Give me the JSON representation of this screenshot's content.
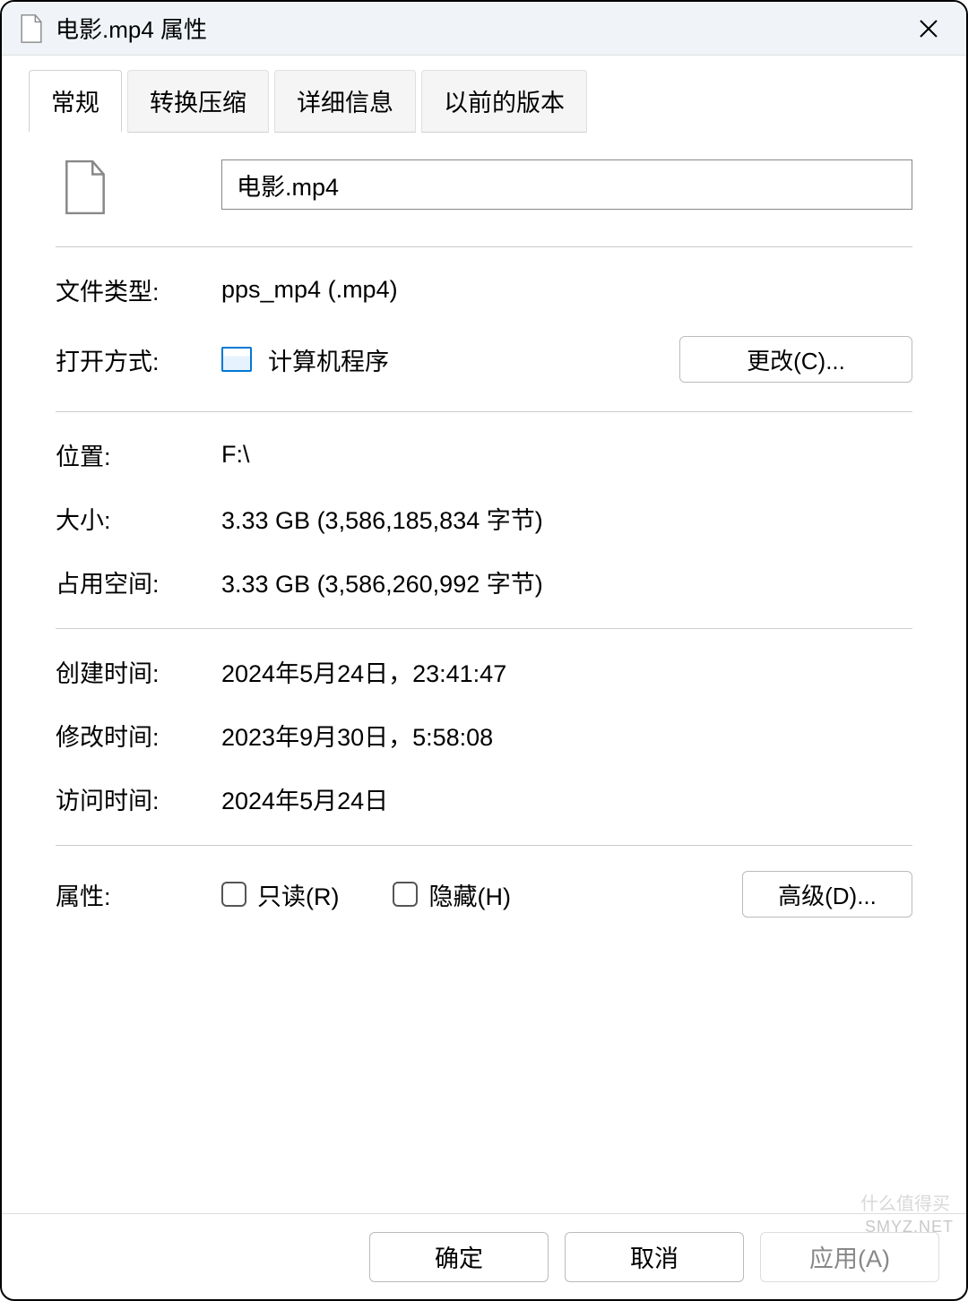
{
  "window": {
    "title": "电影.mp4 属性"
  },
  "tabs": [
    {
      "label": "常规",
      "active": true
    },
    {
      "label": "转换压缩",
      "active": false
    },
    {
      "label": "详细信息",
      "active": false
    },
    {
      "label": "以前的版本",
      "active": false
    }
  ],
  "filename": "电影.mp4",
  "labels": {
    "file_type": "文件类型:",
    "opens_with": "打开方式:",
    "location": "位置:",
    "size": "大小:",
    "size_on_disk": "占用空间:",
    "created": "创建时间:",
    "modified": "修改时间:",
    "accessed": "访问时间:",
    "attributes": "属性:"
  },
  "values": {
    "file_type": "pps_mp4 (.mp4)",
    "opens_with": "计算机程序",
    "location": "F:\\",
    "size": "3.33 GB (3,586,185,834 字节)",
    "size_on_disk": "3.33 GB (3,586,260,992 字节)",
    "created": "2024年5月24日，23:41:47",
    "modified": "2023年9月30日，5:58:08",
    "accessed": "2024年5月24日"
  },
  "buttons": {
    "change": "更改(C)...",
    "advanced": "高级(D)...",
    "ok": "确定",
    "cancel": "取消",
    "apply": "应用(A)"
  },
  "checkboxes": {
    "readonly": "只读(R)",
    "hidden": "隐藏(H)"
  },
  "watermark": {
    "text1": "什么值得买",
    "text2": "SMYZ.NET"
  }
}
